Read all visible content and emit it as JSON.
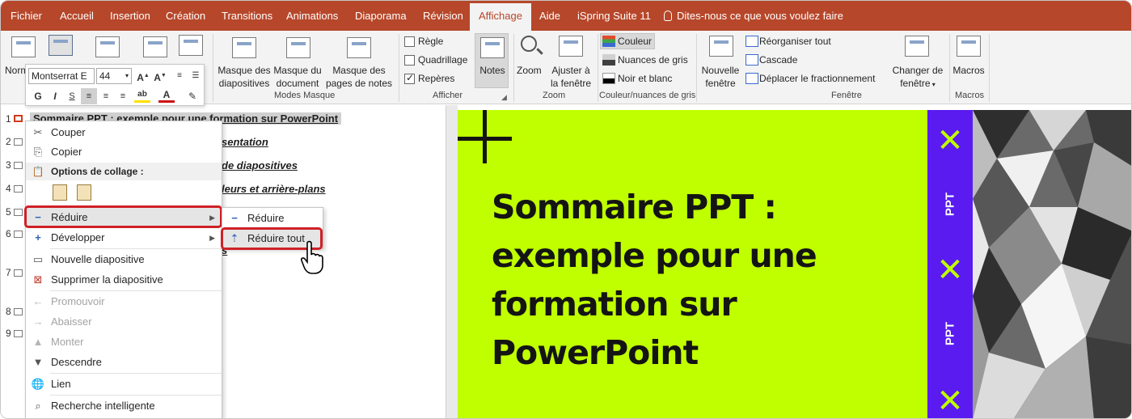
{
  "tabs": [
    {
      "label": "Fichier"
    },
    {
      "label": "Accueil"
    },
    {
      "label": "Insertion"
    },
    {
      "label": "Création"
    },
    {
      "label": "Transitions"
    },
    {
      "label": "Animations"
    },
    {
      "label": "Diaporama"
    },
    {
      "label": "Révision"
    },
    {
      "label": "Affichage"
    },
    {
      "label": "Aide"
    },
    {
      "label": "iSpring Suite 11"
    }
  ],
  "tell_me": "Dites-nous ce que vous voulez faire",
  "ribbon": {
    "normal_partial": "Norm",
    "masque_diapositives": [
      "Masque des",
      "diapositives"
    ],
    "masque_document": [
      "Masque du",
      "document"
    ],
    "masque_notes": [
      "Masque des",
      "pages de notes"
    ],
    "group_modes_masque": "Modes Masque",
    "regle": "Règle",
    "quadrillage": "Quadrillage",
    "reperes": "Repères",
    "notes": "Notes",
    "group_afficher": "Afficher",
    "zoom": "Zoom",
    "ajuster": [
      "Ajuster à",
      "la fenêtre"
    ],
    "group_zoom": "Zoom",
    "couleur": "Couleur",
    "nuances": "Nuances de gris",
    "noir_blanc": "Noir et blanc",
    "group_couleur": "Couleur/nuances de gris",
    "nouvelle_fenetre": [
      "Nouvelle",
      "fenêtre"
    ],
    "reorganiser": "Réorganiser tout",
    "cascade": "Cascade",
    "deplacer": "Déplacer le fractionnement",
    "group_fenetre": "Fenêtre",
    "changer_fenetre": [
      "Changer de",
      "fenêtre"
    ],
    "macros": "Macros",
    "group_macros": "Macros"
  },
  "mini_toolbar": {
    "font": "Montserrat E",
    "size": "44",
    "bold": "G",
    "italic": "I"
  },
  "outline": {
    "numbers": [
      "1",
      "2",
      "3",
      "4",
      "5",
      "6",
      "7",
      "8",
      "9"
    ],
    "line1": "Sommaire PPT : exemple pour une formation sur PowerPoint",
    "line2": "sentation",
    "line3": "de diapositives",
    "line4": "leurs et arrière-plans",
    "line7": "s"
  },
  "context_menu": {
    "couper": "Couper",
    "copier": "Copier",
    "options_collage": "Options de collage :",
    "reduire": "Réduire",
    "developper": "Développer",
    "nouvelle_diapositive": "Nouvelle diapositive",
    "supprimer": "Supprimer la diapositive",
    "promouvoir": "Promouvoir",
    "abaisser": "Abaisser",
    "monter": "Monter",
    "descendre": "Descendre",
    "lien": "Lien",
    "recherche": "Recherche intelligente"
  },
  "submenu": {
    "reduire": "Réduire",
    "reduire_tout": "Réduire tout"
  },
  "slide": {
    "title": "Sommaire PPT : exemple pour une formation sur PowerPoint",
    "band_label": "PPT",
    "band_mark": "✕"
  },
  "colors": {
    "ribbon_accent": "#b7472a",
    "slide_background": "#c0ff00",
    "band": "#5a1bf0",
    "highlight": "#cf2127"
  }
}
